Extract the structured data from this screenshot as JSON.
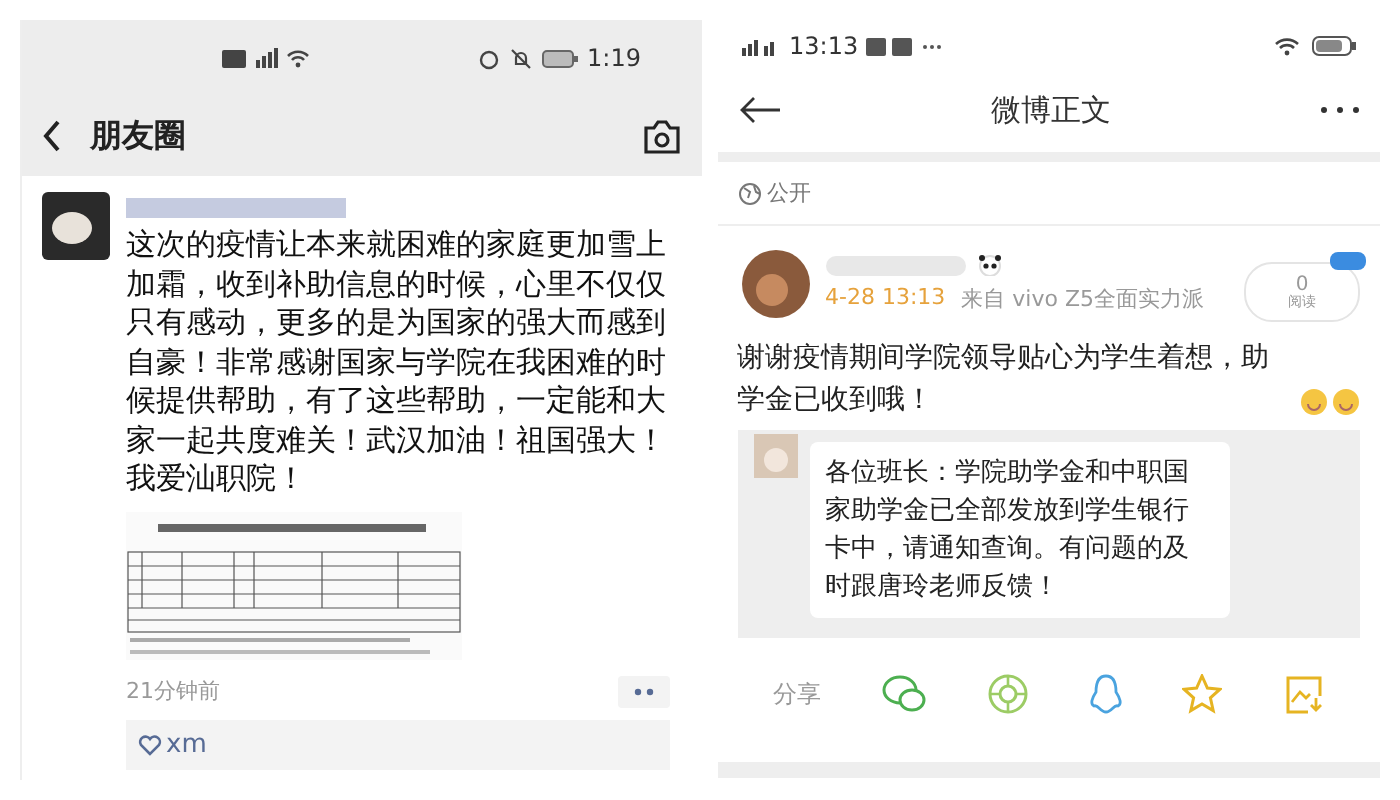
{
  "wechat": {
    "status": {
      "time": "1:19"
    },
    "nav": {
      "title": "朋友圈"
    },
    "post": {
      "text": "这次的疫情让本来就困难的家庭更加雪上加霜，收到补助信息的时候，心里不仅仅只有感动，更多的是为国家的强大而感到自豪！非常感谢国家与学院在我困难的时候提供帮助，有了这些帮助，一定能和大家一起共度难关！武汉加油！祖国强大！我爱汕职院！",
      "time": "21分钟前",
      "likes": "xm"
    }
  },
  "weibo": {
    "status": {
      "time": "13:13"
    },
    "nav": {
      "title": "微博正文"
    },
    "visibility": "公开",
    "post": {
      "date": "4-28 13:13",
      "source": "来自 vivo Z5全面实力派",
      "read_count": "0",
      "read_label": "阅读",
      "text": "谢谢疫情期间学院领导贴心为学生着想，助学金已收到哦！",
      "quote": "各位班长：学院助学金和中职国家助学金已全部发放到学生银行卡中，请通知查询。有问题的及时跟唐玲老师反馈！"
    },
    "share_label": "分享"
  }
}
